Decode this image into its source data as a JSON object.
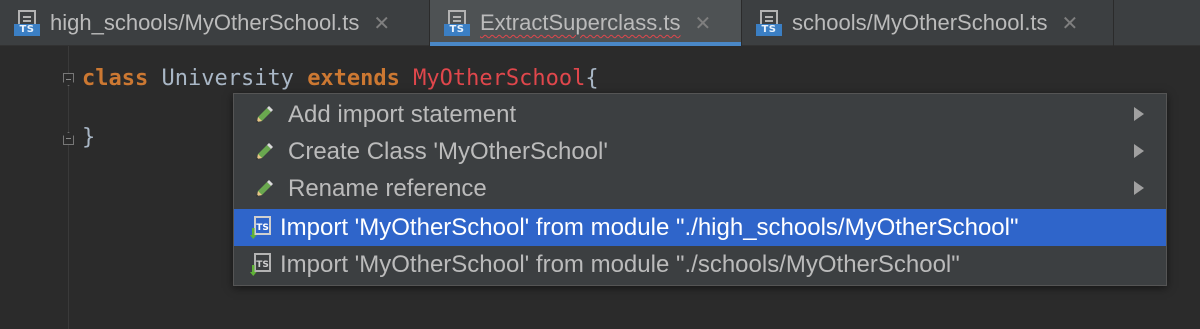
{
  "tabs": [
    {
      "label": "high_schools/MyOtherSchool.ts",
      "icon": "typescript-file-icon",
      "icon_badge": "TS",
      "close": "✕",
      "active": false
    },
    {
      "label": "ExtractSuperclass.ts",
      "icon": "typescript-file-icon",
      "icon_badge": "TS",
      "close": "✕",
      "active": true
    },
    {
      "label": "schools/MyOtherSchool.ts",
      "icon": "typescript-file-icon",
      "icon_badge": "TS",
      "close": "✕",
      "active": false
    }
  ],
  "editor": {
    "line1": {
      "kw_class": "class",
      "name": " University ",
      "kw_extends": "extends",
      "unresolved": " MyOtherSchool",
      "brace": "{"
    },
    "line2": {
      "brace": "}"
    }
  },
  "popup": {
    "items": [
      {
        "label": "Add import statement",
        "icon": "pencil-icon",
        "submenu": true
      },
      {
        "label": "Create Class 'MyOtherSchool'",
        "icon": "pencil-icon",
        "submenu": true
      },
      {
        "label": "Rename reference",
        "icon": "pencil-icon",
        "submenu": true
      },
      {
        "label": "Import 'MyOtherSchool' from module \"./high_schools/MyOtherSchool\"",
        "icon": "ts-import-icon",
        "icon_badge": "TS",
        "selected": true
      },
      {
        "label": "Import 'MyOtherSchool' from module \"./schools/MyOtherSchool\"",
        "icon": "ts-import-icon",
        "icon_badge": "TS",
        "selected": false
      }
    ]
  },
  "colors": {
    "background": "#2b2b2b",
    "tabbar": "#3c3f41",
    "active_tab_underline": "#4a88c7",
    "keyword": "#cc7832",
    "error": "#e0474c",
    "selection": "#2f65ca"
  }
}
